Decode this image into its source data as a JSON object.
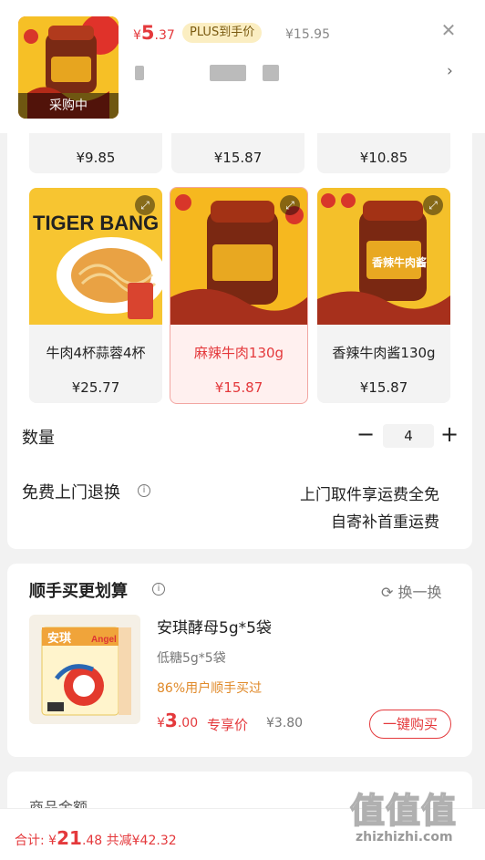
{
  "header": {
    "thumb_badge": "采购中",
    "price_symbol": "¥",
    "price_int": "5",
    "price_dec": ".37",
    "plus_label": "PLUS到手价",
    "original_price": "¥15.95",
    "close_icon": "close-icon",
    "chevron_icon": "chevron-right-icon"
  },
  "options": {
    "top_row_prices": [
      "¥9.85",
      "¥15.87",
      "¥10.85"
    ],
    "cards": [
      {
        "label": "牛肉4杯蒜蓉4杯",
        "price": "¥25.77",
        "image_text": "TIGER BANG",
        "selected": false
      },
      {
        "label": "麻辣牛肉130g",
        "price": "¥15.87",
        "image_text": "",
        "selected": true
      },
      {
        "label": "香辣牛肉酱130g",
        "price": "¥15.87",
        "image_text": "香辣牛肉酱",
        "selected": false
      }
    ],
    "expand_icon": "expand-icon"
  },
  "quantity": {
    "label": "数量",
    "minus": "−",
    "value": "4",
    "plus": "+"
  },
  "returns": {
    "label": "免费上门退换",
    "info_icon": "info-icon",
    "line1": "上门取件享运费全免",
    "line2": "自寄补首重运费"
  },
  "combo": {
    "title": "顺手买更划算",
    "swap_label": "换一换",
    "product_name": "安琪酵母5g*5袋",
    "spec": "低糖5g*5袋",
    "note": "86%用户顺手买过",
    "price_symbol": "¥",
    "price_int": "3",
    "price_dec": ".00",
    "price_tag": "专享价",
    "old_price": "¥3.80",
    "buy_label": "一键购买",
    "product_image_text": "安琪",
    "product_image_sub": "Angel"
  },
  "amount": {
    "label": "商品金额"
  },
  "footer": {
    "total_label": "合计: ",
    "total_symbol": "¥",
    "total_int": "21",
    "total_dec": ".48",
    "discount": " 共减¥42.32"
  },
  "watermark": {
    "glyphs": "值值值",
    "site": "zhizhizhi.com"
  },
  "colors": {
    "accent": "#e4393c",
    "plus_bg": "#fbeec2",
    "note": "#e08a2a"
  }
}
